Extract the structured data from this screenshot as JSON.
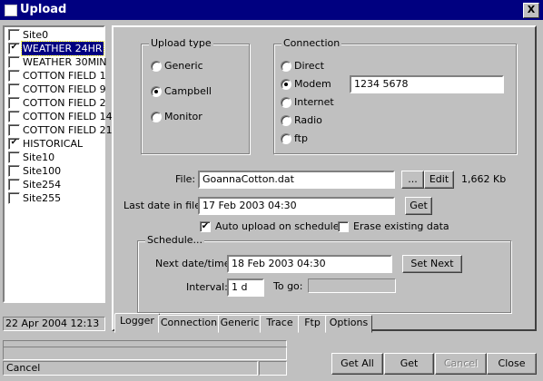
{
  "window": {
    "title": "Upload",
    "close_glyph": "X"
  },
  "sites": [
    {
      "label": "Site0",
      "checked": false,
      "selected": false
    },
    {
      "label": "WEATHER 24HR",
      "checked": true,
      "selected": true
    },
    {
      "label": "WEATHER 30MIN",
      "checked": false,
      "selected": false
    },
    {
      "label": "COTTON FIELD 1",
      "checked": false,
      "selected": false
    },
    {
      "label": "COTTON FIELD 9",
      "checked": false,
      "selected": false
    },
    {
      "label": "COTTON FIELD 2",
      "checked": false,
      "selected": false
    },
    {
      "label": "COTTON FIELD 14",
      "checked": false,
      "selected": false
    },
    {
      "label": "COTTON FIELD 21",
      "checked": false,
      "selected": false
    },
    {
      "label": "HISTORICAL",
      "checked": true,
      "selected": false
    },
    {
      "label": "Site10",
      "checked": false,
      "selected": false
    },
    {
      "label": "Site100",
      "checked": false,
      "selected": false
    },
    {
      "label": "Site254",
      "checked": false,
      "selected": false
    },
    {
      "label": "Site255",
      "checked": false,
      "selected": false
    }
  ],
  "status_date": "22 Apr 2004 12:13",
  "upload_type": {
    "title": "Upload type",
    "options": [
      "Generic",
      "Campbell",
      "Monitor"
    ],
    "selected": "Campbell"
  },
  "connection": {
    "title": "Connection",
    "options": [
      "Direct",
      "Modem",
      "Internet",
      "Radio",
      "ftp"
    ],
    "selected": "Modem",
    "modem_number": "1234 5678"
  },
  "file": {
    "label": "File:",
    "value": "GoannaCotton.dat",
    "browse_label": "...",
    "edit_label": "Edit",
    "size": "1,662 Kb"
  },
  "last_date": {
    "label": "Last date in file:",
    "value": "17 Feb 2003 04:30",
    "get_label": "Get"
  },
  "auto_upload": {
    "label": "Auto upload on schedule",
    "checked": true
  },
  "erase_data": {
    "label": "Erase existing data",
    "checked": false
  },
  "schedule": {
    "title": "Schedule...",
    "next_label": "Next date/time:",
    "next_value": "18 Feb 2003 04:30",
    "set_next_label": "Set Next",
    "interval_label": "Interval:",
    "interval_value": "1 d",
    "togo_label": "To go:",
    "togo_value": ""
  },
  "tabs": [
    "Logger",
    "Connection",
    "Generic",
    "Trace",
    "Ftp",
    "Options"
  ],
  "active_tab": "Logger",
  "statusbar": {
    "text": "Cancel"
  },
  "buttons": {
    "get_all": "Get All",
    "get": "Get",
    "cancel": "Cancel",
    "close": "Close"
  },
  "colors": {
    "selection": "#000080",
    "face": "#c0c0c0",
    "titlebar": "#000080"
  }
}
